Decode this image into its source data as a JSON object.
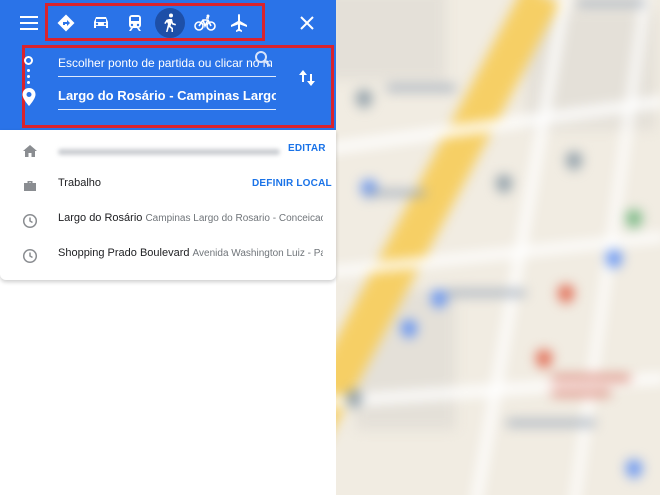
{
  "travel_modes": [
    {
      "id": "best",
      "icon": "directions-icon",
      "active": false
    },
    {
      "id": "car",
      "icon": "car-icon",
      "active": false
    },
    {
      "id": "transit",
      "icon": "train-icon",
      "active": false
    },
    {
      "id": "walk",
      "icon": "walking-icon",
      "active": true
    },
    {
      "id": "bike",
      "icon": "bicycle-icon",
      "active": false
    },
    {
      "id": "flight",
      "icon": "airplane-icon",
      "active": false
    }
  ],
  "origin": {
    "placeholder": "Escolher ponto de partida ou clicar no m",
    "value": ""
  },
  "destination": {
    "value": "Largo do Rosário - Campinas Largo do R"
  },
  "saved_places": {
    "home": {
      "label": "",
      "action": "EDITAR"
    },
    "work": {
      "label": "Trabalho",
      "action": "DEFINIR LOCAL"
    }
  },
  "recent": [
    {
      "title": "Largo do Rosário",
      "subtitle": "Campinas Largo do Rosario - Conceicao..."
    },
    {
      "title": "Shopping Prado Boulevard",
      "subtitle": "Avenida Washington Luiz - Pa..."
    }
  ],
  "colors": {
    "header": "#2a73e8",
    "highlight": "#d9232d",
    "link": "#1a73e8"
  }
}
